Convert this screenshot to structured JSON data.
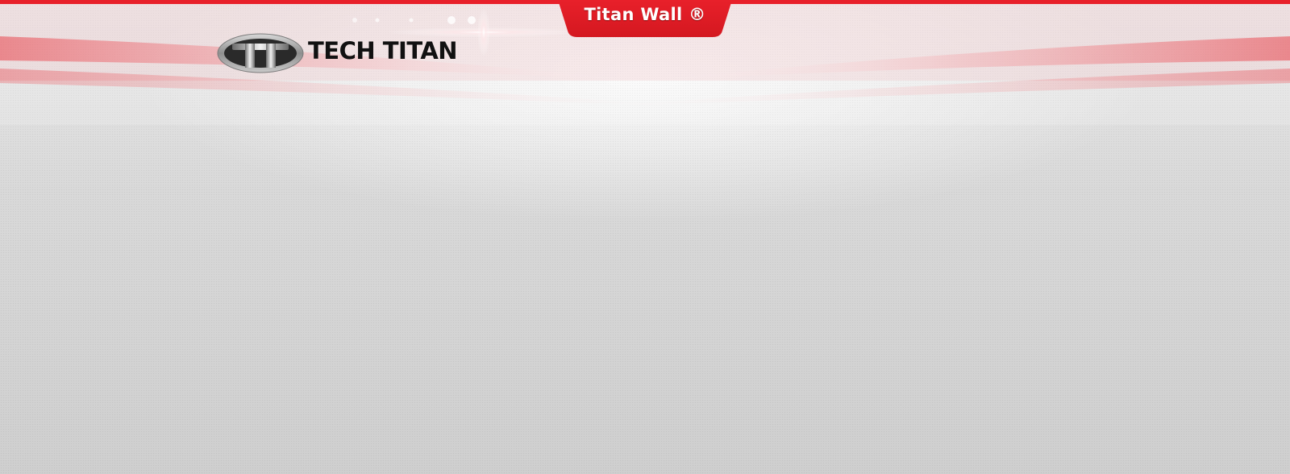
{
  "header": {
    "tab_label": "Titan Wall ®",
    "logo": {
      "text_part1": "TECH",
      "text_part2": "TITAN",
      "wordmark": "TECH TITAN",
      "icon": "titan-t-emblem-icon"
    }
  },
  "colors": {
    "accent_red": "#e8202a",
    "background": "#d9d9d9",
    "logo_text": "#111111"
  }
}
